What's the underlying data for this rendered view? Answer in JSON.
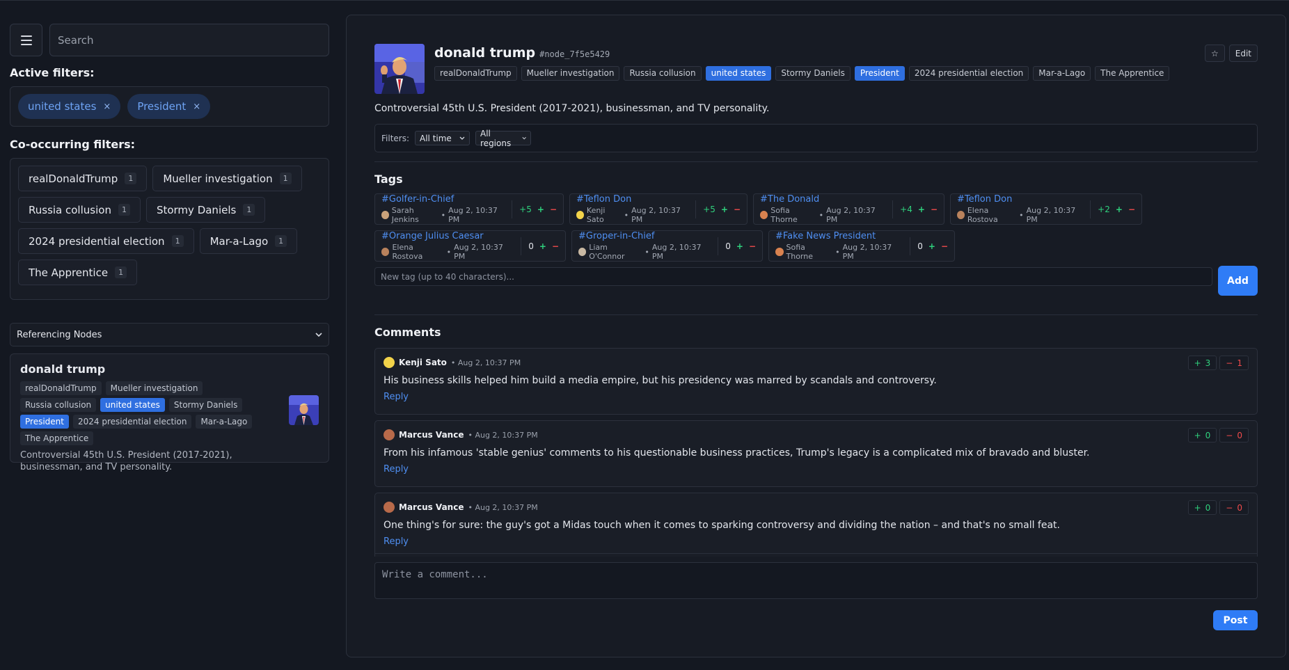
{
  "sidebar": {
    "search_placeholder": "Search",
    "active_filters_title": "Active filters:",
    "active_filters": [
      {
        "label": "united states",
        "remove": "×"
      },
      {
        "label": "President",
        "remove": "×"
      }
    ],
    "cooccurring_title": "Co-occurring filters:",
    "cooccurring": [
      {
        "label": "realDonaldTrump",
        "count": "1"
      },
      {
        "label": "Mueller investigation",
        "count": "1"
      },
      {
        "label": "Russia collusion",
        "count": "1"
      },
      {
        "label": "Stormy Daniels",
        "count": "1"
      },
      {
        "label": "2024 presidential election",
        "count": "1"
      },
      {
        "label": "Mar-a-Lago",
        "count": "1"
      },
      {
        "label": "The Apprentice",
        "count": "1"
      }
    ],
    "referencing_select": "Referencing Nodes",
    "ref_card": {
      "name": "donald trump",
      "tags": [
        "realDonaldTrump",
        "Mueller investigation",
        "Russia collusion",
        "united states",
        "Stormy Daniels",
        "President",
        "2024 presidential election",
        "Mar-a-Lago",
        "The Apprentice"
      ],
      "description": "Controversial 45th U.S. President (2017-2021), businessman, and TV personality."
    }
  },
  "node": {
    "title": "donald trump",
    "id": "#node_7f5e5429",
    "tags": [
      "realDonaldTrump",
      "Mueller investigation",
      "Russia collusion",
      "united states",
      "Stormy Daniels",
      "President",
      "2024 presidential election",
      "Mar-a-Lago",
      "The Apprentice"
    ],
    "highlighted_tags": [
      "united states",
      "President"
    ],
    "star_label": "☆",
    "edit_label": "Edit",
    "description": "Controversial 45th U.S. President (2017-2021), businessman, and TV personality.",
    "filters_label": "Filters:",
    "time_filter": "All time",
    "region_filter": "All regions"
  },
  "tags_section": {
    "title": "Tags",
    "rows": [
      [
        {
          "name": "#Golfer-in-Chief",
          "author": "Sarah Jenkins",
          "time": "Aug 2, 10:37 PM",
          "score": "+5",
          "avatar_color": "#c9a27a"
        },
        {
          "name": "#Teflon Don",
          "author": "Kenji Sato",
          "time": "Aug 2, 10:37 PM",
          "score": "+5",
          "avatar_color": "#f2d34a"
        },
        {
          "name": "#The Donald",
          "author": "Sofia Thorne",
          "time": "Aug 2, 10:37 PM",
          "score": "+4",
          "avatar_color": "#d9824f"
        },
        {
          "name": "#Teflon Don",
          "author": "Elena Rostova",
          "time": "Aug 2, 10:37 PM",
          "score": "+2",
          "avatar_color": "#b9825c"
        }
      ],
      [
        {
          "name": "#Orange Julius Caesar",
          "author": "Elena Rostova",
          "time": "Aug 2, 10:37 PM",
          "score": "0",
          "avatar_color": "#b9825c"
        },
        {
          "name": "#Groper-in-Chief",
          "author": "Liam O'Connor",
          "time": "Aug 2, 10:37 PM",
          "score": "0",
          "avatar_color": "#c8b8a2"
        },
        {
          "name": "#Fake News President",
          "author": "Sofia Thorne",
          "time": "Aug 2, 10:37 PM",
          "score": "0",
          "avatar_color": "#d9824f"
        }
      ]
    ],
    "input_placeholder": "New tag (up to 40 characters)...",
    "add_label": "Add",
    "plus": "+",
    "minus": "−"
  },
  "comments_section": {
    "title": "Comments",
    "items": [
      {
        "author": "Kenji Sato",
        "time": "• Aug 2, 10:37 PM",
        "text": "His business skills helped him build a media empire, but his presidency was marred by scandals and controversy.",
        "reply": "Reply",
        "up": "3",
        "down": "1",
        "avatar_color": "#f2d34a"
      },
      {
        "author": "Marcus Vance",
        "time": "• Aug 2, 10:37 PM",
        "text": "From his infamous 'stable genius' comments to his questionable business practices, Trump's legacy is a complicated mix of bravado and bluster.",
        "reply": "Reply",
        "up": "0",
        "down": "0",
        "avatar_color": "#b86a4a"
      },
      {
        "author": "Marcus Vance",
        "time": "• Aug 2, 10:37 PM",
        "text": "One thing's for sure: the guy's got a Midas touch when it comes to sparking controversy and dividing the nation – and that's no small feat.",
        "reply": "Reply",
        "up": "0",
        "down": "0",
        "avatar_color": "#b86a4a"
      }
    ],
    "input_placeholder": "Write a comment...",
    "post_label": "Post"
  }
}
